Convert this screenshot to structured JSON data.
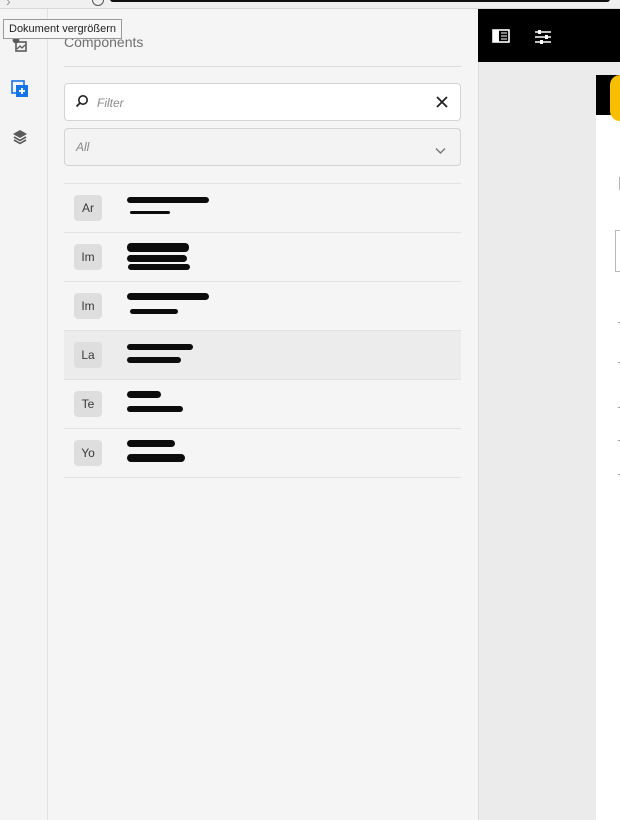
{
  "browser": {
    "tooltip": "Dokument vergrößern"
  },
  "rail": {
    "icons": [
      "image-asset-icon",
      "add-component-icon",
      "layers-icon"
    ],
    "accent": "#1473e6"
  },
  "panel": {
    "title": "Components",
    "filter": {
      "placeholder": "Filter",
      "value": ""
    },
    "group_select": {
      "selected": "All"
    },
    "components": [
      {
        "badge": "Ar",
        "title": "",
        "subtitle": ""
      },
      {
        "badge": "Im",
        "title": "",
        "subtitle": ""
      },
      {
        "badge": "Im",
        "title": "",
        "subtitle": ""
      },
      {
        "badge": "La",
        "title": "",
        "subtitle": ""
      },
      {
        "badge": "Te",
        "title": "",
        "subtitle": ""
      },
      {
        "badge": "Yo",
        "title": "",
        "subtitle": ""
      }
    ]
  },
  "editor_toolbar": {
    "icons": [
      "side-panel-icon",
      "properties-icon"
    ]
  },
  "canvas": {
    "visible_heading_glyph": "I",
    "accent": "#f7bf00"
  }
}
